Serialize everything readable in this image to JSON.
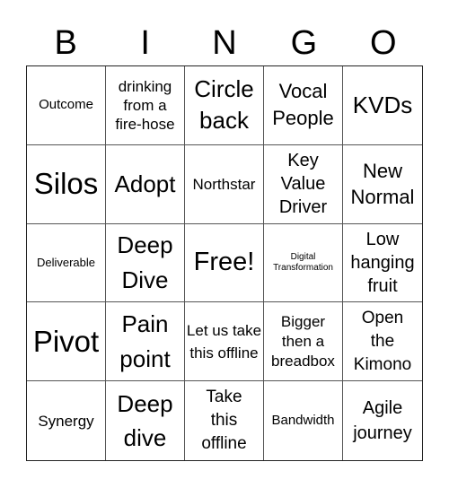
{
  "header": {
    "letters": [
      "B",
      "I",
      "N",
      "G",
      "O"
    ]
  },
  "card": {
    "rows": [
      [
        "Outcome",
        "drinking from a fire-hose",
        "Circle back",
        "Vocal People",
        "KVDs"
      ],
      [
        "Silos",
        "Adopt",
        "Northstar",
        "Key Value Driver",
        "New Normal"
      ],
      [
        "Deliverable",
        "Deep Dive",
        "Free!",
        "Digital Transformation",
        "Low hanging fruit"
      ],
      [
        "Pivot",
        "Pain point",
        "Let us take this offline",
        "Bigger then a breadbox",
        "Open the Kimono"
      ],
      [
        "Synergy",
        "Deep dive",
        "Take this offline",
        "Bandwidth",
        "Agile journey"
      ]
    ]
  }
}
